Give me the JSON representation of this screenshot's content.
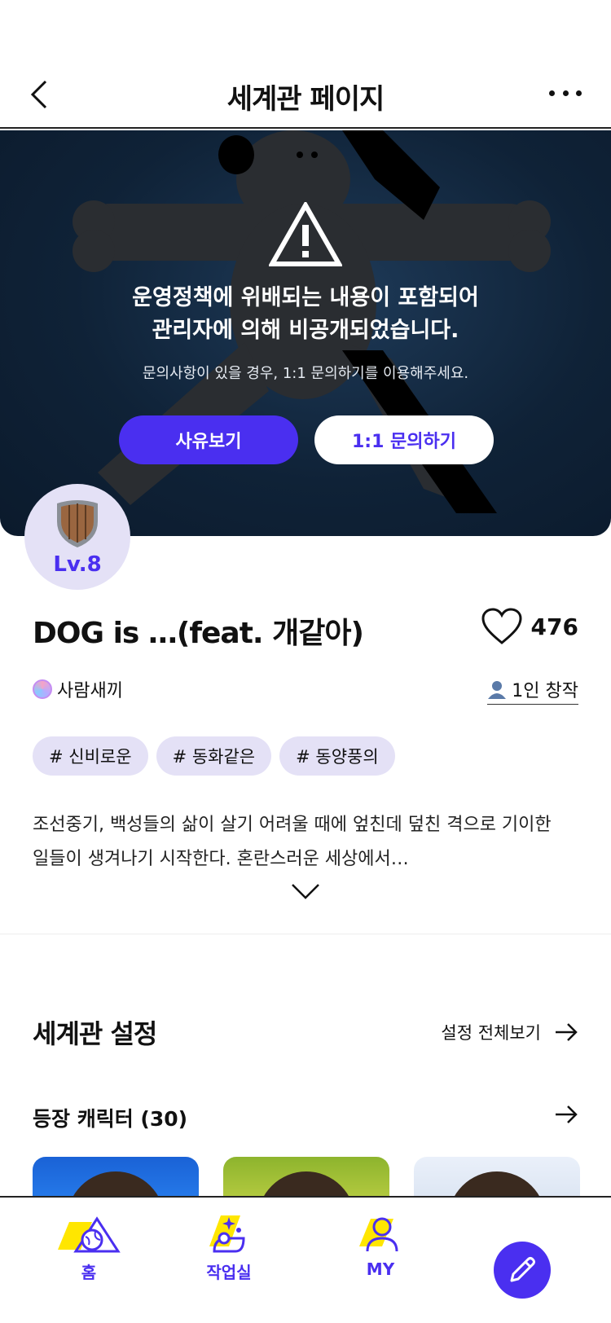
{
  "header": {
    "title": "세계관 페이지"
  },
  "banner": {
    "warning_line1": "운영정책에 위배되는 내용이 포함되어",
    "warning_line2": "관리자에 의해 비공개되었습니다.",
    "subtext": "문의사항이 있을 경우, 1:1 문의하기를 이용해주세요.",
    "reason_button": "사유보기",
    "inquiry_button": "1:1 문의하기"
  },
  "level": {
    "label": "Lv.8"
  },
  "world": {
    "title": "DOG is …(feat. 개같아)",
    "like_count": "476",
    "author": "사람새끼",
    "creators": "1인 창작",
    "tags": [
      "# 신비로운",
      "# 동화같은",
      "# 동양풍의"
    ],
    "description_line1": "조선중기, 백성들의 삶이 살기 어려울 때에 엎친데 덮친 격으로 기이한",
    "description_line2": "일들이 생겨나기 시작한다. 혼란스러운 세상에서…"
  },
  "settings": {
    "section_title": "세계관 설정",
    "see_all": "설정 전체보기",
    "characters_title": "등장 캐릭터 (30)"
  },
  "nav": {
    "home": "홈",
    "studio": "작업실",
    "my": "MY"
  },
  "colors": {
    "accent": "#4a2ff0",
    "tag_bg": "#e4e1f6",
    "nav_highlight": "#ffe600"
  }
}
